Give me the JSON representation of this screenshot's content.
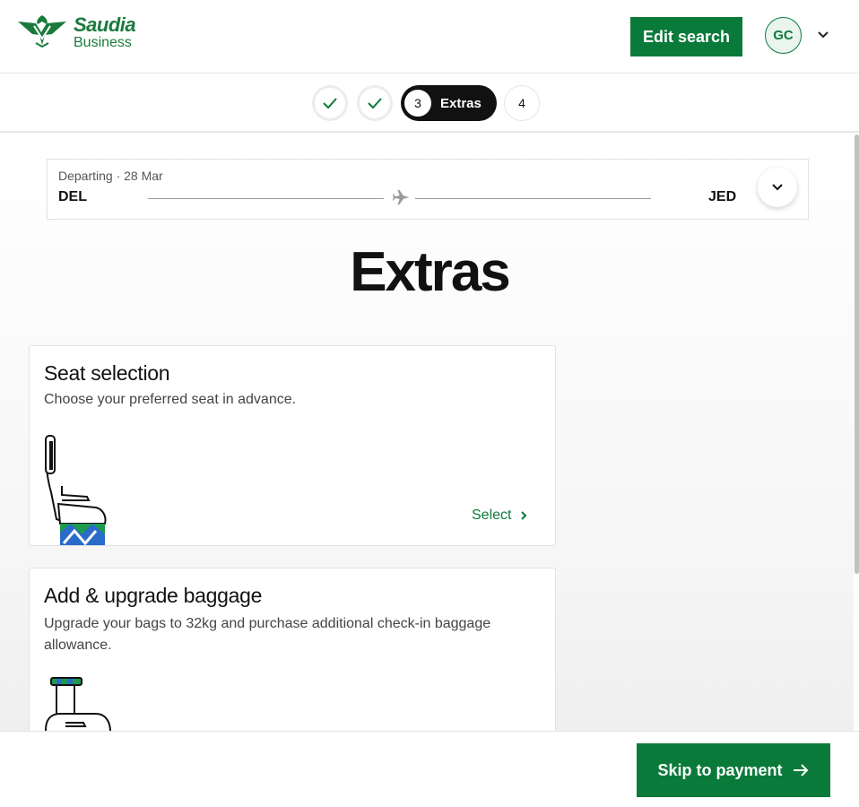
{
  "header": {
    "brand_name": "Saudia",
    "brand_sub": "Business",
    "edit_search_label": "Edit search",
    "user_initials": "GC",
    "brand_color": "#0a7a3a"
  },
  "stepper": {
    "steps": [
      {
        "state": "completed",
        "icon": "check-icon"
      },
      {
        "state": "completed",
        "icon": "check-icon"
      },
      {
        "number": "3",
        "label": "Extras",
        "state": "active"
      },
      {
        "number": "4",
        "state": "upcoming"
      }
    ]
  },
  "flight": {
    "label": "Departing · 28 Mar",
    "origin": "DEL",
    "destination": "JED"
  },
  "page": {
    "title": "Extras"
  },
  "cards": [
    {
      "title": "Seat selection",
      "description": "Choose your preferred seat in advance.",
      "action_label": "Select",
      "illustration": "seat-illustration"
    },
    {
      "title": "Add & upgrade baggage",
      "description": "Upgrade your bags to 32kg and purchase additional check-in baggage allowance.",
      "illustration": "suitcase-illustration"
    }
  ],
  "footer": {
    "skip_label": "Skip to payment"
  }
}
